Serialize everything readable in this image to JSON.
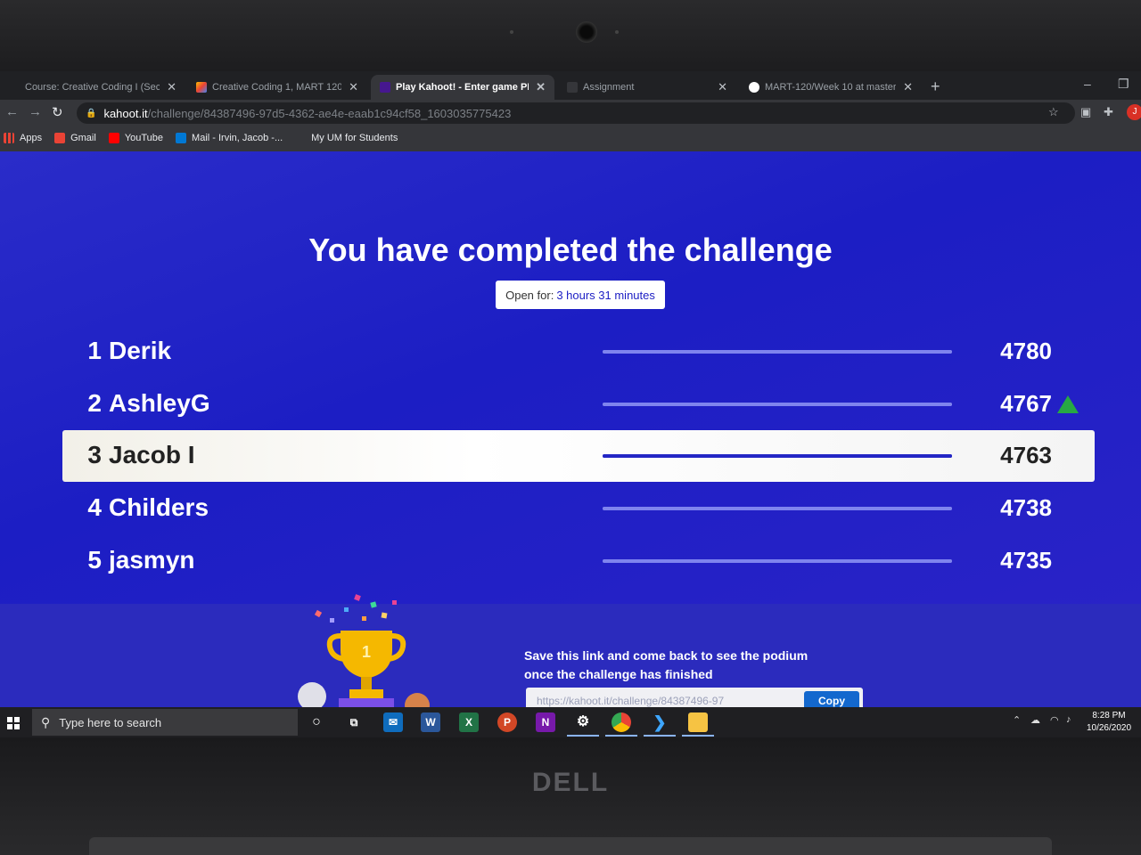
{
  "browser": {
    "tabs": [
      {
        "label": "Course: Creative Coding I (Sect",
        "active": false
      },
      {
        "label": "Creative Coding 1, MART 120 |",
        "active": false
      },
      {
        "label": "Play Kahoot! - Enter game PIN h",
        "active": true
      },
      {
        "label": "Assignment",
        "active": false
      },
      {
        "label": "MART-120/Week 10 at master",
        "active": false
      }
    ],
    "url_host": "kahoot.it",
    "url_path": "/challenge/84387496-97d5-4362-ae4e-eaab1c94cf58_1603035775423",
    "bookmarks": [
      "Apps",
      "Gmail",
      "YouTube",
      "Mail - Irvin, Jacob -...",
      "My UM for Students"
    ],
    "profile_initial": "J"
  },
  "kahoot": {
    "title": "You have completed the challenge",
    "open_for_label": "Open for:",
    "open_for_value": "3 hours 31 minutes",
    "leaderboard": [
      {
        "rank": "1",
        "name": "Derik",
        "score": "4780",
        "level": 1.0,
        "current_user": false,
        "trend_up": false
      },
      {
        "rank": "2",
        "name": "AshleyG",
        "score": "4767",
        "level": 1.0,
        "current_user": false,
        "trend_up": true
      },
      {
        "rank": "3",
        "name": "Jacob I",
        "score": "4763",
        "level": 1.0,
        "current_user": true,
        "trend_up": false
      },
      {
        "rank": "4",
        "name": "Childers",
        "score": "4738",
        "level": 1.0,
        "current_user": false,
        "trend_up": false
      },
      {
        "rank": "5",
        "name": "jasmyn",
        "score": "4735",
        "level": 1.0,
        "current_user": false,
        "trend_up": false
      }
    ],
    "save_message_line1": "Save this link and come back to see the podium",
    "save_message_line2": "once the challenge has finished",
    "link_value": "https://kahoot.it/challenge/84387496-97",
    "copy_label": "Copy",
    "trophy_rank": "1",
    "colors": {
      "background": "#1c1ec4",
      "highlight_row": "#ffffff",
      "trend_up": "#27a844"
    }
  },
  "taskbar": {
    "search_placeholder": "Type here to search",
    "time": "8:28 PM",
    "date": "10/26/2020",
    "apps": [
      "cortana-icon",
      "task-view-icon",
      "mail-icon",
      "word-icon",
      "excel-icon",
      "powerpoint-icon",
      "onenote-icon",
      "settings-icon",
      "chrome-icon",
      "vscode-icon",
      "file-explorer-icon"
    ]
  },
  "laptop_brand": "DELL"
}
